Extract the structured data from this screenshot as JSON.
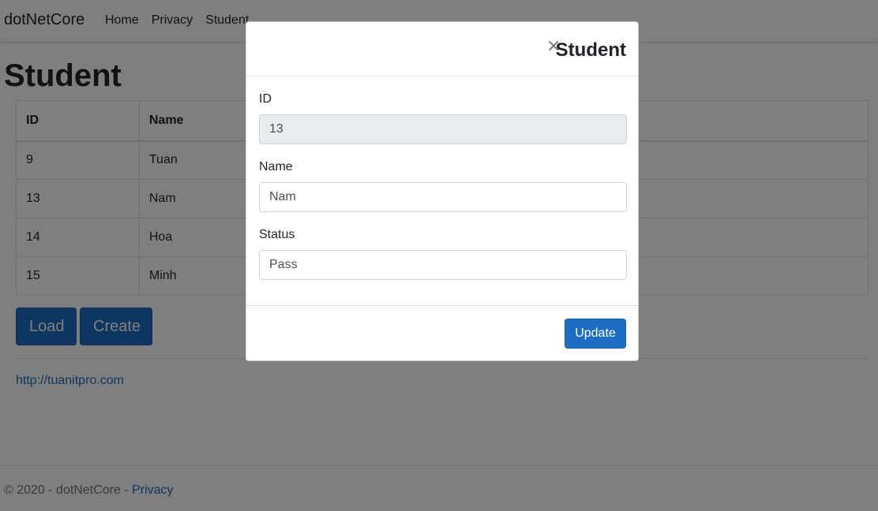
{
  "nav": {
    "brand": "dotNetCore",
    "items": [
      {
        "label": "Home"
      },
      {
        "label": "Privacy"
      },
      {
        "label": "Student"
      }
    ]
  },
  "page": {
    "title": "Student"
  },
  "table": {
    "headers": [
      "ID",
      "Name"
    ],
    "rows": [
      [
        "9",
        "Tuan"
      ],
      [
        "13",
        "Nam"
      ],
      [
        "14",
        "Hoa"
      ],
      [
        "15",
        "Minh"
      ]
    ]
  },
  "actions": {
    "load_label": "Load",
    "create_label": "Create"
  },
  "link": {
    "text": "http://tuanitpro.com"
  },
  "footer": {
    "text": "© 2020 - dotNetCore - ",
    "privacy": "Privacy"
  },
  "modal": {
    "title": "Student",
    "close": "×",
    "fields": {
      "id": {
        "label": "ID",
        "value": "13"
      },
      "name": {
        "label": "Name",
        "value": "Nam"
      },
      "status": {
        "label": "Status",
        "value": "Pass"
      }
    },
    "update_label": "Update"
  }
}
